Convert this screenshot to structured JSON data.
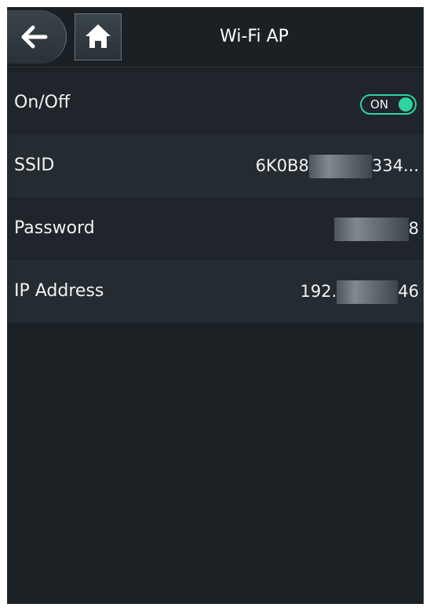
{
  "header": {
    "title": "Wi-Fi AP",
    "back_icon": "arrow-left-icon",
    "home_icon": "home-icon"
  },
  "rows": [
    {
      "label": "On/Off",
      "toggle_text": "ON",
      "toggle_state": true
    },
    {
      "label": "SSID",
      "value_prefix": "6K0B8",
      "value_suffix": "334..."
    },
    {
      "label": "Password",
      "value_suffix": "8"
    },
    {
      "label": "IP Address",
      "value_prefix": "192.",
      "value_suffix": "46"
    }
  ],
  "colors": {
    "background": "#1c2125",
    "row": "#252c31",
    "row_alt": "#1f252a",
    "accent": "#2bd4a0",
    "text": "#f2f2f2"
  }
}
